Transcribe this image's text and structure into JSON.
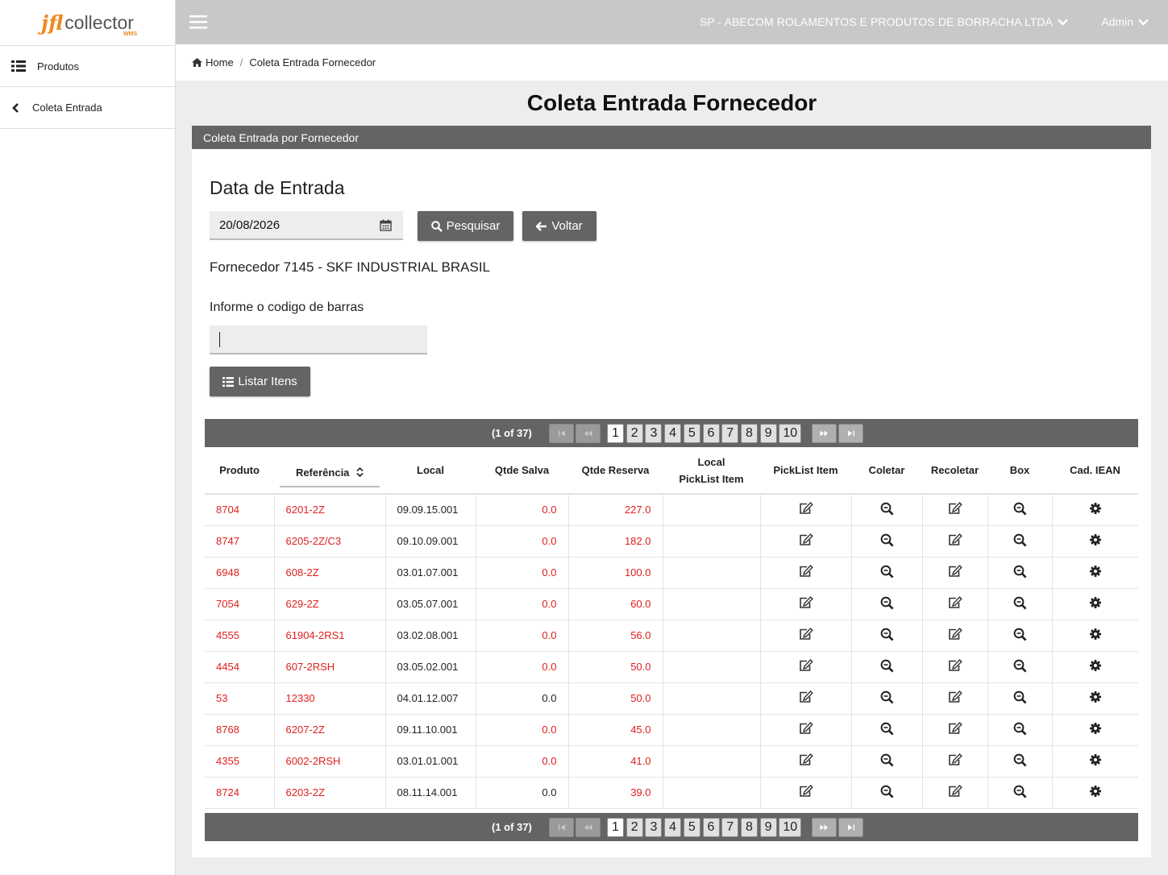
{
  "app": {
    "logo_jfl": "jfl",
    "logo_collector": "collector",
    "logo_wms": "WMS"
  },
  "sidebar": {
    "items": [
      {
        "label": "Produtos",
        "icon": "list-icon"
      },
      {
        "label": "Coleta Entrada",
        "icon": "chevron-left-icon"
      }
    ]
  },
  "topbar": {
    "company": "SP - ABECOM ROLAMENTOS E PRODUTOS DE BORRACHA LTDA",
    "user": "Admin"
  },
  "breadcrumb": {
    "home": "Home",
    "separator": "/",
    "current": "Coleta Entrada Fornecedor"
  },
  "page": {
    "title": "Coleta Entrada Fornecedor",
    "panel_title": "Coleta Entrada por Fornecedor",
    "date_heading": "Data de Entrada",
    "date_value": "20/08/2026",
    "search_label": "Pesquisar",
    "back_label": "Voltar",
    "supplier": "Fornecedor 7145 - SKF INDUSTRIAL BRASIL",
    "barcode_label": "Informe o codigo de barras",
    "barcode_value": "",
    "list_label": "Listar Itens"
  },
  "pager": {
    "count": "(1 of 37)",
    "pages": [
      "1",
      "2",
      "3",
      "4",
      "5",
      "6",
      "7",
      "8",
      "9",
      "10"
    ],
    "current": "1"
  },
  "table": {
    "headers": [
      "Produto",
      "Referência",
      "Local",
      "Qtde Salva",
      "Qtde Reserva",
      "Local PickList Item",
      "PickList Item",
      "Coletar",
      "Recoletar",
      "Box",
      "Cad. IEAN"
    ],
    "rows": [
      {
        "produto": "8704",
        "referencia": "6201-2Z",
        "local": "09.09.15.001",
        "salva": "0.0",
        "reserva": "227.0",
        "red_local": false,
        "red_salva": true
      },
      {
        "produto": "8747",
        "referencia": "6205-2Z/C3",
        "local": "09.10.09.001",
        "salva": "0.0",
        "reserva": "182.0",
        "red_local": false,
        "red_salva": true
      },
      {
        "produto": "6948",
        "referencia": "608-2Z",
        "local": "03.01.07.001",
        "salva": "0.0",
        "reserva": "100.0",
        "red_local": false,
        "red_salva": true
      },
      {
        "produto": "7054",
        "referencia": "629-2Z",
        "local": "03.05.07.001",
        "salva": "0.0",
        "reserva": "60.0",
        "red_local": false,
        "red_salva": true
      },
      {
        "produto": "4555",
        "referencia": "61904-2RS1",
        "local": "03.02.08.001",
        "salva": "0.0",
        "reserva": "56.0",
        "red_local": false,
        "red_salva": true
      },
      {
        "produto": "4454",
        "referencia": "607-2RSH",
        "local": "03.05.02.001",
        "salva": "0.0",
        "reserva": "50.0",
        "red_local": false,
        "red_salva": true
      },
      {
        "produto": "53",
        "referencia": "12330",
        "local": "04.01.12.007",
        "salva": "0.0",
        "reserva": "50.0",
        "red_local": false,
        "red_salva": false
      },
      {
        "produto": "8768",
        "referencia": "6207-2Z",
        "local": "09.11.10.001",
        "salva": "0.0",
        "reserva": "45.0",
        "red_local": false,
        "red_salva": true
      },
      {
        "produto": "4355",
        "referencia": "6002-2RSH",
        "local": "03.01.01.001",
        "salva": "0.0",
        "reserva": "41.0",
        "red_local": false,
        "red_salva": true
      },
      {
        "produto": "8724",
        "referencia": "6203-2Z",
        "local": "08.11.14.001",
        "salva": "0.0",
        "reserva": "39.0",
        "red_local": false,
        "red_salva": false
      }
    ]
  },
  "colors": {
    "accent_red": "#e02020",
    "bar_gray": "#646464",
    "logo_orange": "#f08a24"
  }
}
